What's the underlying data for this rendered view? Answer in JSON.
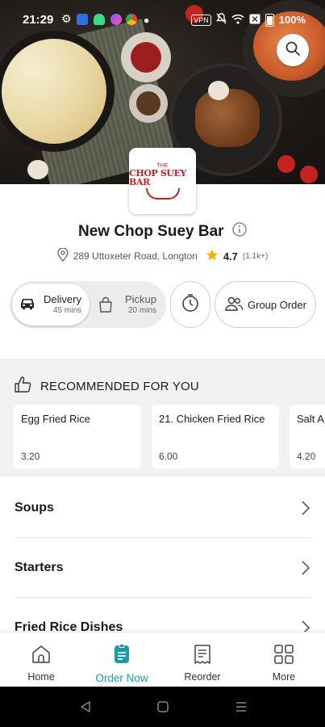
{
  "status_bar": {
    "time": "21:29",
    "vpn": "VPN",
    "battery": "100%",
    "icons": [
      "gear-icon",
      "m-app-icon",
      "android-icon",
      "messenger-icon",
      "chrome-icon",
      "dot-icon",
      "vpn-icon",
      "mute-icon",
      "wifi-icon",
      "close-box-icon",
      "battery-icon"
    ]
  },
  "header": {
    "search_icon": "search-icon"
  },
  "restaurant": {
    "logo_text_top": "THE",
    "logo_text": "CHOP SUEY BAR",
    "name": "New Chop Suey Bar",
    "address": "289 Uttoxeter Road, Longton",
    "rating": "4.7",
    "rating_count": "(1.1k+)"
  },
  "order_mode": {
    "delivery": {
      "label": "Delivery",
      "time": "45 mins",
      "selected": true
    },
    "pickup": {
      "label": "Pickup",
      "time": "20 mins",
      "selected": false
    },
    "group_order": "Group Order"
  },
  "recommended": {
    "title": "RECOMMENDED FOR YOU",
    "items": [
      {
        "name": "Egg Fried Rice",
        "price": "3.20"
      },
      {
        "name": "21. Chicken Fried Rice",
        "price": "6.00"
      },
      {
        "name": "Salt A",
        "price": "4.20"
      }
    ]
  },
  "categories": [
    {
      "label": "Soups"
    },
    {
      "label": "Starters"
    },
    {
      "label": "Fried Rice Dishes"
    }
  ],
  "bottom_nav": {
    "items": [
      {
        "label": "Home",
        "icon": "home-icon"
      },
      {
        "label": "Order Now",
        "icon": "order-icon",
        "active": true
      },
      {
        "label": "Reorder",
        "icon": "receipt-icon"
      },
      {
        "label": "More",
        "icon": "grid-icon"
      }
    ]
  },
  "colors": {
    "accent": "#1e9aa6",
    "star": "#f5b400",
    "brand_red": "#c61f25"
  }
}
